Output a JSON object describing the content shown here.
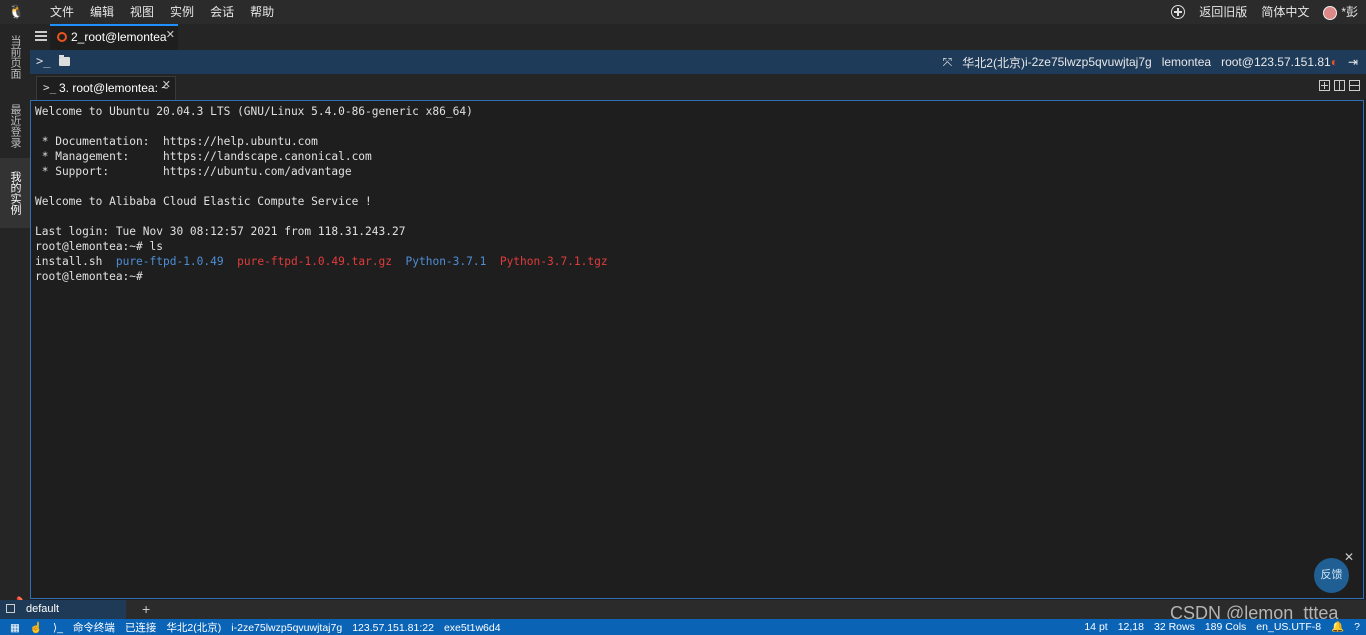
{
  "menubar": {
    "items": [
      "文件",
      "编辑",
      "视图",
      "实例",
      "会话",
      "帮助"
    ],
    "back_old": "返回旧版",
    "language": "简体中文",
    "user": "*彭"
  },
  "sidebar": {
    "tabs": [
      "当前页面",
      "最近登录",
      "我的实例"
    ]
  },
  "session": {
    "tab_label": "2_root@lemontea"
  },
  "infobar": {
    "region": "华北2(北京)",
    "instance_id": "i-2ze75lwzp5qvuwjtaj7g",
    "host": "lemontea",
    "user_ip": "root@123.57.151.81"
  },
  "terminal_tab": {
    "label": "3. root@lemontea: ~"
  },
  "terminal": {
    "lines": [
      "Welcome to Ubuntu 20.04.3 LTS (GNU/Linux 5.4.0-86-generic x86_64)",
      "",
      " * Documentation:  https://help.ubuntu.com",
      " * Management:     https://landscape.canonical.com",
      " * Support:        https://ubuntu.com/advantage",
      "",
      "Welcome to Alibaba Cloud Elastic Compute Service !",
      "",
      "Last login: Tue Nov 30 08:12:57 2021 from 118.31.243.27",
      "root@lemontea:~# ls"
    ],
    "ls_output": {
      "file1": "install.sh",
      "dir1": "pure-ftpd-1.0.49",
      "archive1": "pure-ftpd-1.0.49.tar.gz",
      "dir2": "Python-3.7.1",
      "archive2": "Python-3.7.1.tgz"
    },
    "prompt": "root@lemontea:~#"
  },
  "feedback": {
    "label": "反馈"
  },
  "bottom": {
    "tab_label": "default"
  },
  "status": {
    "left": [
      "命令终端",
      "已连接",
      "华北2(北京)",
      "i-2ze75lwzp5qvuwjtaj7g",
      "123.57.151.81:22",
      "exe5t1w6d4"
    ],
    "font_size": "14 pt",
    "cursor": "12,18",
    "rows": "32 Rows",
    "cols": "189 Cols",
    "encoding": "en_US.UTF-8"
  },
  "watermark": "CSDN @lemon_tttea",
  "colors": {
    "accent": "#0a63b5",
    "dir_blue": "#4f8ed6",
    "archive_red": "#e03c3c"
  }
}
